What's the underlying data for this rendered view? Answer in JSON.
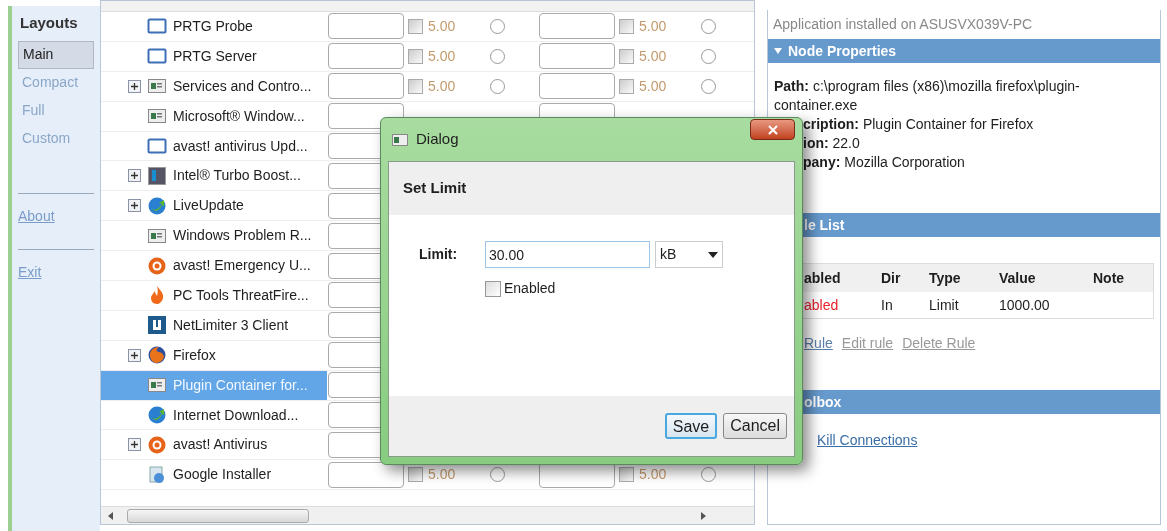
{
  "sidebar": {
    "title": "Layouts",
    "items": [
      {
        "label": "Main",
        "selected": true
      },
      {
        "label": "Compact",
        "selected": false
      },
      {
        "label": "Full",
        "selected": false
      },
      {
        "label": "Custom",
        "selected": false
      }
    ],
    "links": [
      "About",
      "Exit"
    ]
  },
  "table": {
    "rows": [
      {
        "name": "PRTG Probe",
        "kind": "window",
        "expandable": false,
        "selected": false,
        "limits": [
          {
            "value": "5.00",
            "checked": false,
            "on": false
          },
          {
            "value": "5.00",
            "checked": false,
            "on": false
          }
        ]
      },
      {
        "name": "PRTG Server",
        "kind": "window",
        "expandable": false,
        "selected": false,
        "limits": [
          {
            "value": "5.00",
            "checked": false,
            "on": false
          },
          {
            "value": "5.00",
            "checked": false,
            "on": false
          }
        ]
      },
      {
        "name": "Services and Contro...",
        "kind": "app",
        "expandable": true,
        "selected": false,
        "limits": [
          {
            "value": "5.00",
            "checked": false,
            "on": false
          },
          {
            "value": "5.00",
            "checked": false,
            "on": false
          }
        ]
      },
      {
        "name": "Microsoft® Window...",
        "kind": "app",
        "expandable": false,
        "selected": false
      },
      {
        "name": "avast! antivirus Upd...",
        "kind": "window",
        "expandable": false,
        "selected": false
      },
      {
        "name": "Intel® Turbo Boost...",
        "kind": "chip",
        "expandable": true,
        "selected": false
      },
      {
        "name": "LiveUpdate",
        "kind": "globe",
        "expandable": true,
        "selected": false
      },
      {
        "name": "Windows Problem R...",
        "kind": "app",
        "expandable": false,
        "selected": false
      },
      {
        "name": "avast! Emergency U...",
        "kind": "ring",
        "expandable": false,
        "selected": false
      },
      {
        "name": "PC Tools ThreatFire...",
        "kind": "flame",
        "expandable": false,
        "selected": false
      },
      {
        "name": "NetLimiter 3 Client",
        "kind": "square",
        "expandable": false,
        "selected": false
      },
      {
        "name": "Firefox",
        "kind": "fox",
        "expandable": true,
        "selected": false
      },
      {
        "name": "Plugin Container for...",
        "kind": "app",
        "expandable": false,
        "selected": true
      },
      {
        "name": "Internet Download...",
        "kind": "globe",
        "expandable": false,
        "selected": false
      },
      {
        "name": "avast! Antivirus",
        "kind": "ring",
        "expandable": true,
        "selected": false
      },
      {
        "name": "Google Installer",
        "kind": "installer",
        "expandable": false,
        "selected": false,
        "limits": [
          {
            "value": "5.00",
            "checked": false,
            "on": false
          },
          {
            "value": "5.00",
            "checked": false,
            "on": false
          }
        ]
      }
    ]
  },
  "details": {
    "subtitle": "Application installed on ASUSVX039V-PC",
    "node_properties": {
      "title": "Node Properties",
      "expanded": true,
      "lines": [
        {
          "label": "Path:",
          "value": "c:\\program files (x86)\\mozilla firefox\\plugin-container.exe",
          "behind_dialog": false
        },
        {
          "label": "cription:",
          "value": "Plugin Container for Firefox",
          "behind_dialog": true
        },
        {
          "label": "ion:",
          "value": "22.0",
          "behind_dialog": true
        },
        {
          "label": "pany:",
          "value": "Mozilla Corporation",
          "behind_dialog": true
        }
      ]
    },
    "rule_list": {
      "title": "le List",
      "columns": [
        "abled",
        "Dir",
        "Type",
        "Value",
        "Note"
      ],
      "rows": [
        {
          "enabled": false,
          "cells": [
            "abled",
            "In",
            "Limit",
            "1000.00",
            ""
          ]
        }
      ],
      "links": [
        {
          "label": "Rule",
          "disabled": false
        },
        {
          "label": "Edit rule",
          "disabled": true
        },
        {
          "label": "Delete Rule",
          "disabled": true
        }
      ]
    },
    "toolbox": {
      "title": "olbox",
      "links": [
        "Kill Connections"
      ]
    }
  },
  "dialog": {
    "title": "Dialog",
    "heading": "Set Limit",
    "field_label": "Limit:",
    "value": "30.00",
    "unit": "kB",
    "checkbox": {
      "label": "Enabled",
      "checked": false
    },
    "buttons": [
      {
        "label": "Save",
        "focused": true
      },
      {
        "label": "Cancel",
        "focused": false
      }
    ]
  }
}
